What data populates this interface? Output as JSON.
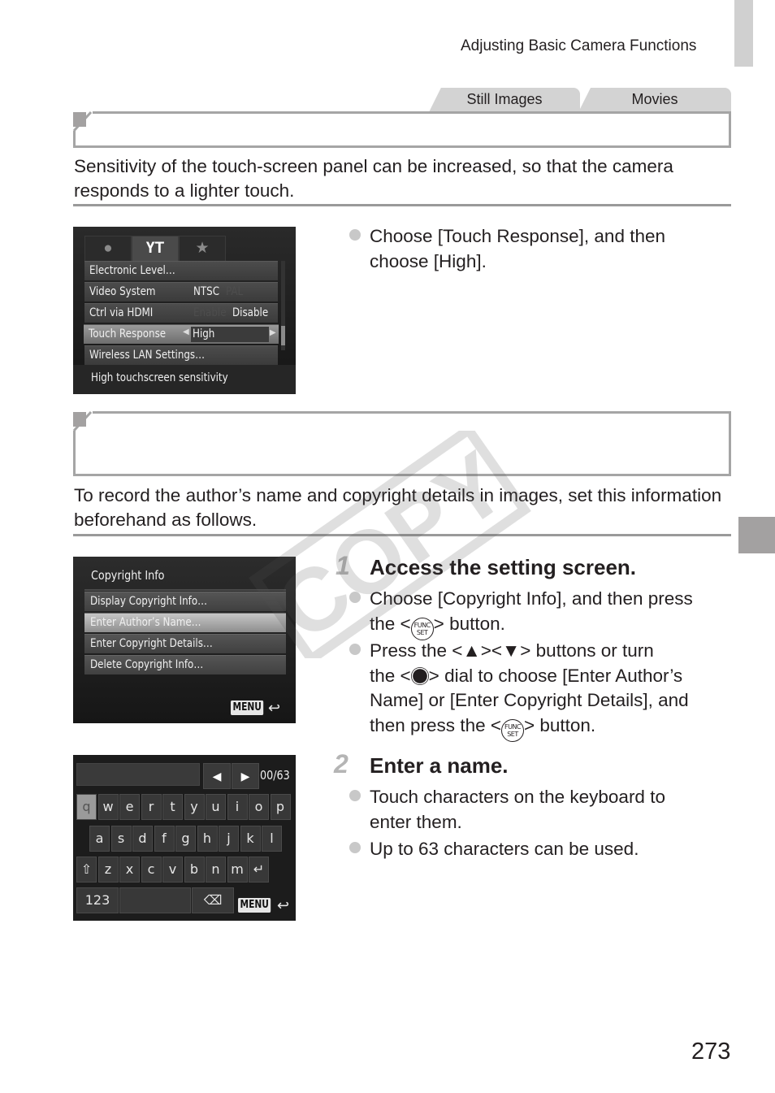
{
  "header": {
    "chapter_title": "Adjusting Basic Camera Functions"
  },
  "mode_tabs": [
    {
      "label": "Still Images"
    },
    {
      "label": "Movies"
    }
  ],
  "section1": {
    "heading": "",
    "intro": "Sensitivity of the touch-screen panel can be increased, so that the camera responds to a lighter touch.",
    "screen": {
      "tabs": [
        {
          "icon": "camera-icon",
          "glyph": "●"
        },
        {
          "icon": "wrench-settings-icon",
          "glyph": "ҮT"
        },
        {
          "icon": "star-icon",
          "glyph": "★"
        }
      ],
      "rows": [
        {
          "label": "Electronic Level…",
          "value": "",
          "dim_value": ""
        },
        {
          "label": "Video System",
          "value": "NTSC",
          "dim_value": "PAL"
        },
        {
          "label": "Ctrl via HDMI",
          "dim_value": "Enable",
          "value": "Disable"
        },
        {
          "label": "Touch Response",
          "value": "High",
          "dim_value": ""
        },
        {
          "label": "Wireless LAN Settings…",
          "value": "",
          "dim_value": ""
        }
      ],
      "hint": "High touchscreen sensitivity"
    },
    "instructions": [
      {
        "text": "Choose [Touch Response], and then choose [High]."
      }
    ]
  },
  "section2": {
    "heading": "",
    "intro": "To record the author’s name and copyright details in images, set this information beforehand as follows.",
    "screen_copyright": {
      "title": "Copyright Info",
      "rows": [
        {
          "label": "Display Copyright Info…"
        },
        {
          "label": "Enter Author’s Name…"
        },
        {
          "label": "Enter Copyright Details…"
        },
        {
          "label": "Delete Copyright Info…"
        }
      ],
      "menu_button": "MENU",
      "back_icon": "↩"
    },
    "screen_keyboard": {
      "counter": "00/63",
      "row1": [
        "q",
        "w",
        "e",
        "r",
        "t",
        "y",
        "u",
        "i",
        "o",
        "p"
      ],
      "row2": [
        "a",
        "s",
        "d",
        "f",
        "g",
        "h",
        "j",
        "k",
        "l"
      ],
      "row3": [
        "⇧",
        "z",
        "x",
        "c",
        "v",
        "b",
        "n",
        "m",
        "↵"
      ],
      "mode_key": "123",
      "backspace_key": "⌫",
      "menu_button": "MENU",
      "back_icon": "↩"
    },
    "steps": [
      {
        "number": "1",
        "title": "Access the setting screen.",
        "bullets": [
          {
            "parts": [
              "Choose [Copyright Info], and then press the <",
              "> button."
            ]
          },
          {
            "line1": "Press the <▲><▼> buttons or turn the <",
            "line2": "> dial to choose [Enter Author’s Name] or [Enter Copyright Details], and then press the <",
            "line3": "> button."
          }
        ],
        "func_label_top": "FUNC",
        "func_label_bottom": "SET"
      },
      {
        "number": "2",
        "title": "Enter a name.",
        "bullets": [
          {
            "text": "Touch characters on the keyboard to enter them."
          },
          {
            "text": "Up to 63 characters can be used."
          }
        ]
      }
    ]
  },
  "watermark": "COPY",
  "page_number": "273"
}
